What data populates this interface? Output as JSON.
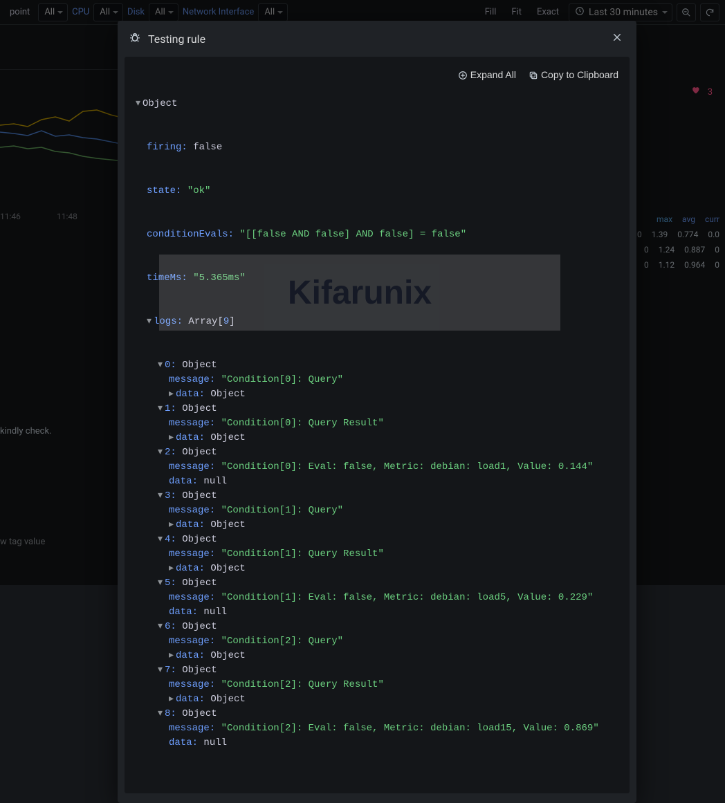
{
  "toolbar": {
    "filters": [
      {
        "label": "point",
        "value": "All"
      },
      {
        "label": "CPU",
        "value": "All"
      },
      {
        "label": "Disk",
        "value": "All"
      },
      {
        "label": "Network Interface",
        "value": "All"
      }
    ],
    "fill": "Fill",
    "fit": "Fit",
    "exact": "Exact",
    "time_range": "Last 30 minutes"
  },
  "bg": {
    "xticks": [
      "11:46",
      "11:48"
    ],
    "heart_count": "3",
    "stats_headers": [
      "max",
      "avg",
      "curr"
    ],
    "stats_rows": [
      [
        "0",
        "1.39",
        "0.774",
        "0.0"
      ],
      [
        "0",
        "1.24",
        "0.887",
        "0"
      ],
      [
        "0",
        "1.12",
        "0.964",
        "0"
      ]
    ],
    "note": "kindly check.",
    "tag_placeholder": "w tag value"
  },
  "modal": {
    "title": "Testing rule",
    "expand_all": "Expand All",
    "copy": "Copy to Clipboard",
    "root_type": "Object",
    "fields": {
      "firing_key": "firing:",
      "firing_val": "false",
      "state_key": "state:",
      "state_val": "\"ok\"",
      "cond_key": "conditionEvals:",
      "cond_val": "\"[[false AND false] AND false] = false\"",
      "time_key": "timeMs:",
      "time_val": "\"5.365ms\"",
      "logs_key": "logs:",
      "logs_type": "Array",
      "logs_len_open": "[",
      "logs_len": "9",
      "logs_len_close": "]",
      "obj": "Object",
      "msg_key": "message:",
      "data_key": "data:",
      "null_val": "null"
    },
    "logs": [
      {
        "idx": "0:",
        "message": "\"Condition[0]: Query\"",
        "data": "Object",
        "expandable": true
      },
      {
        "idx": "1:",
        "message": "\"Condition[0]: Query Result\"",
        "data": "Object",
        "expandable": true
      },
      {
        "idx": "2:",
        "message": "\"Condition[0]: Eval: false, Metric: debian: load1, Value: 0.144\"",
        "data": "null",
        "expandable": false
      },
      {
        "idx": "3:",
        "message": "\"Condition[1]: Query\"",
        "data": "Object",
        "expandable": true
      },
      {
        "idx": "4:",
        "message": "\"Condition[1]: Query Result\"",
        "data": "Object",
        "expandable": true
      },
      {
        "idx": "5:",
        "message": "\"Condition[1]: Eval: false, Metric: debian: load5, Value: 0.229\"",
        "data": "null",
        "expandable": false
      },
      {
        "idx": "6:",
        "message": "\"Condition[2]: Query\"",
        "data": "Object",
        "expandable": true
      },
      {
        "idx": "7:",
        "message": "\"Condition[2]: Query Result\"",
        "data": "Object",
        "expandable": true
      },
      {
        "idx": "8:",
        "message": "\"Condition[2]: Eval: false, Metric: debian: load15, Value: 0.869\"",
        "data": "null",
        "expandable": false
      }
    ]
  }
}
